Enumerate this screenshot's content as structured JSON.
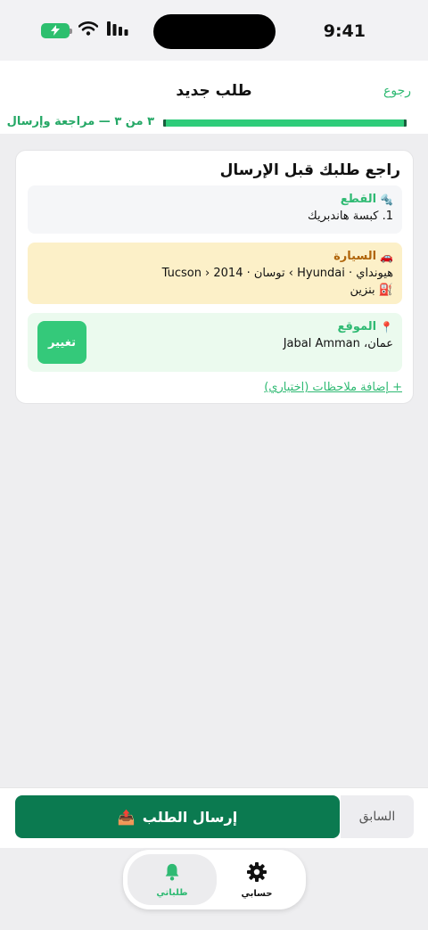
{
  "status_bar": {
    "time": "9:41",
    "icons": [
      "battery-charging-icon",
      "wifi-icon",
      "signal-icon"
    ]
  },
  "header": {
    "title": "طلب جديد",
    "back_label": "رجوع",
    "step_text": "٣ من ٣ — مراجعة وإرسال",
    "progress": 1.0
  },
  "review": {
    "title": "راجع طلبك قبل الإرسال",
    "parts": {
      "icon": "🔩",
      "label": "القطع",
      "items": [
        "1. كبسة هاندبريك"
      ]
    },
    "car": {
      "icon": "🚗",
      "label": "السيارة",
      "line1": "هيونداي · Hyundai › توسان · Tucson › 2014",
      "fuel_icon": "⛽",
      "line2": "بنزين"
    },
    "location": {
      "icon": "📍",
      "label": "الموقع",
      "value": "عمان، Jabal Amman",
      "change_label": "تغيير"
    },
    "add_notes_label": "+ إضافة ملاحظات (اختياري)"
  },
  "actions": {
    "submit_label": "إرسال الطلب",
    "submit_icon": "📤",
    "previous_label": "السابق"
  },
  "nav": {
    "tabs": [
      {
        "label": "طلباتي",
        "icon": "bell-icon",
        "active": true
      },
      {
        "label": "حسابي",
        "icon": "gear-icon",
        "active": false
      }
    ]
  },
  "colors": {
    "accent": "#2fba73",
    "primary_button": "#0b7a50",
    "car_bg": "#fcf0c8",
    "location_bg": "#ebfaee"
  }
}
